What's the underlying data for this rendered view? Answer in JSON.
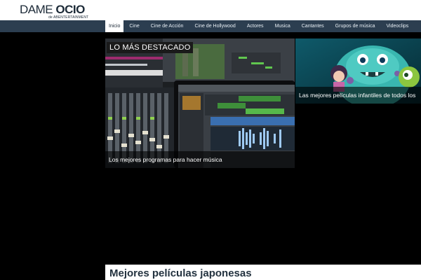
{
  "logo": {
    "dame": "DAME",
    "ocio": "OCIO",
    "sub": "de ABENTERTAINMENT"
  },
  "nav": {
    "items": [
      "Inicio",
      "Cine",
      "Cine de Acción",
      "Cine de Hollywood",
      "Actores",
      "Musica",
      "Cantantes",
      "Grupos de música",
      "Videoclips"
    ],
    "active": "Inicio"
  },
  "slider": {
    "featured_label": "LO MÁS DESTACADO",
    "main_caption": "Los mejores programas para hacer música",
    "right_caption": "Las mejores películas infantiles de todos los"
  },
  "article": {
    "title": "Mejores películas japonesas"
  },
  "colors": {
    "nav_bg": "#2c3e50",
    "logo_text": "#1d2b38",
    "page_bg": "#000000"
  }
}
